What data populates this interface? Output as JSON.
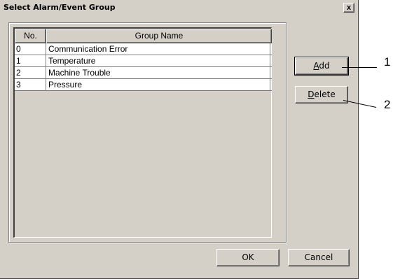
{
  "window": {
    "title": "Select Alarm/Event Group",
    "close_glyph": "x"
  },
  "table": {
    "columns": [
      "No.",
      "Group Name"
    ],
    "rows": [
      {
        "no": "0",
        "name": "Communication Error"
      },
      {
        "no": "1",
        "name": "Temperature"
      },
      {
        "no": "2",
        "name": "Machine Trouble"
      },
      {
        "no": "3",
        "name": "Pressure"
      }
    ]
  },
  "buttons": {
    "add": {
      "accel": "A",
      "rest": "dd"
    },
    "delete": {
      "accel": "D",
      "rest": "elete"
    },
    "ok": "OK",
    "cancel": "Cancel"
  },
  "callouts": [
    "1",
    "2"
  ],
  "colors": {
    "dialog_face": "#d4d0c8",
    "list_background": "#ffffff"
  }
}
